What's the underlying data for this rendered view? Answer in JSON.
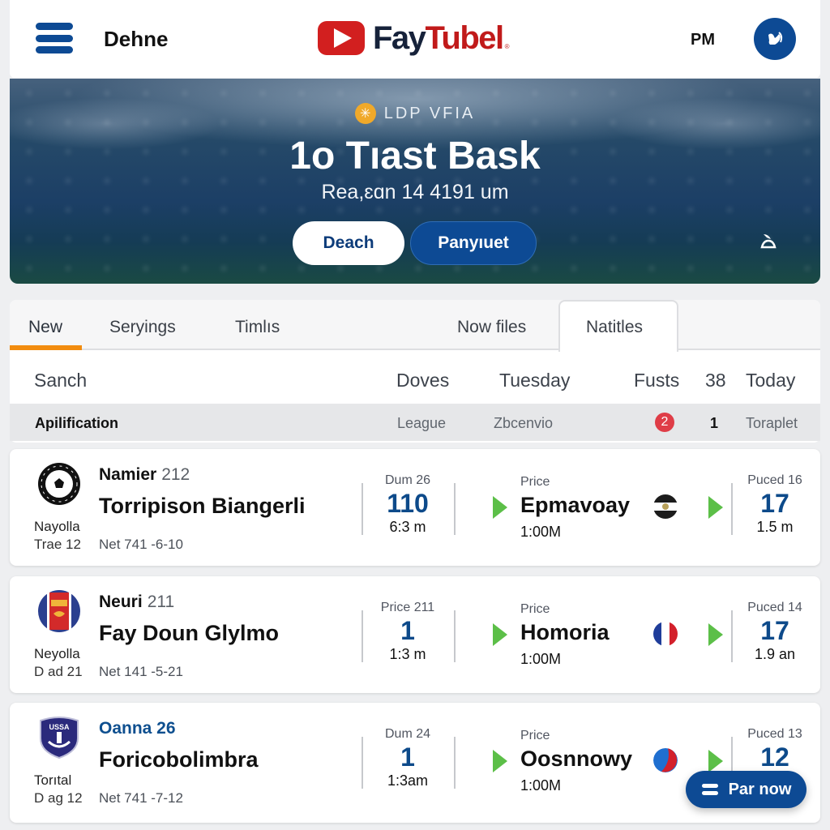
{
  "header": {
    "menu_icon": "hamburger-menu-icon",
    "title": "Dehne",
    "logo_part1": "Fay",
    "logo_part2": "Tubel",
    "logo_mark": "®",
    "time": "PM",
    "avatar_icon": "user-avatar-icon"
  },
  "hero": {
    "badge_icon": "sparkle-icon",
    "badge_text": "LDP VFIA",
    "title": "1o Tıast Bask",
    "subtitle": "Rea,ɛɑn 14 4191 um",
    "primary_button": "Deach",
    "secondary_button": "Panyıuet",
    "corner_icon": "bell-icon"
  },
  "tabs": [
    {
      "label": "New",
      "active": true
    },
    {
      "label": "Seryings"
    },
    {
      "label": "Timlıs"
    },
    {
      "label": "Now files"
    },
    {
      "label": "Natitles",
      "selected_box": true
    }
  ],
  "columns": {
    "search": "Sanch",
    "c1": "Doves",
    "c2": "Tuesday",
    "c3": "Fusts",
    "c4": "38",
    "c5": "Today"
  },
  "filter_row": {
    "label": "Apilification",
    "c1": "League",
    "c2": "Zbcenvio",
    "badge": "2",
    "count": "1",
    "c5": "Toraplet"
  },
  "matches": [
    {
      "crest": "soccer-ball-crest-icon",
      "left_line1": "Nayolla",
      "left_line2": "Trae 12",
      "meta_strong": "Namier",
      "meta_num": "212",
      "team": "Torripison Biangerli",
      "net": "Net 741 -6-10",
      "stat1_label": "Dum 26",
      "stat1_value": "110",
      "stat1_sub": "6:3 m",
      "price_label": "Price",
      "opponent": "Epmavoay",
      "opponent_time": "1:00M",
      "flag": "black-white-crest-flag-icon",
      "stat2_label": "Puced 16",
      "stat2_value": "17",
      "stat2_sub": "1.5 m"
    },
    {
      "crest": "red-blue-crest-icon",
      "left_line1": "Neyolla",
      "left_line2": "D ad 21",
      "meta_strong": "Neuri",
      "meta_num": "211",
      "team": "Fay Doun Glylmo",
      "net": "Net 141 -5-21",
      "stat1_label": "Price 211",
      "stat1_value": "1",
      "stat1_sub": "1:3 m",
      "price_label": "Price",
      "opponent": "Homoria",
      "opponent_time": "1:00M",
      "flag": "france-flag-icon",
      "stat2_label": "Puced 14",
      "stat2_value": "17",
      "stat2_sub": "1.9 an"
    },
    {
      "crest": "anchor-shield-crest-icon",
      "left_line1": "Torıtal",
      "left_line2": "D ag 12",
      "meta_strong": "Oanna 26",
      "meta_num": "",
      "team": "Foricobolimbra",
      "net": "Net 741 -7-12",
      "stat1_label": "Dum 24",
      "stat1_value": "1",
      "stat1_sub": "1:3am",
      "price_label": "Price",
      "opponent": "Oosnnowy",
      "opponent_time": "1:00M",
      "flag": "blue-red-ball-flag-icon",
      "stat2_label": "Puced 13",
      "stat2_value": "12",
      "stat2_sub": ""
    }
  ],
  "fab": {
    "icon": "swap-icon",
    "label": "Par now"
  },
  "colors": {
    "brand_blue": "#0d4a94",
    "brand_red": "#d21f1f",
    "accent_orange": "#f28c0f",
    "play_green": "#5cbf48",
    "badge_red": "#df3d47"
  }
}
